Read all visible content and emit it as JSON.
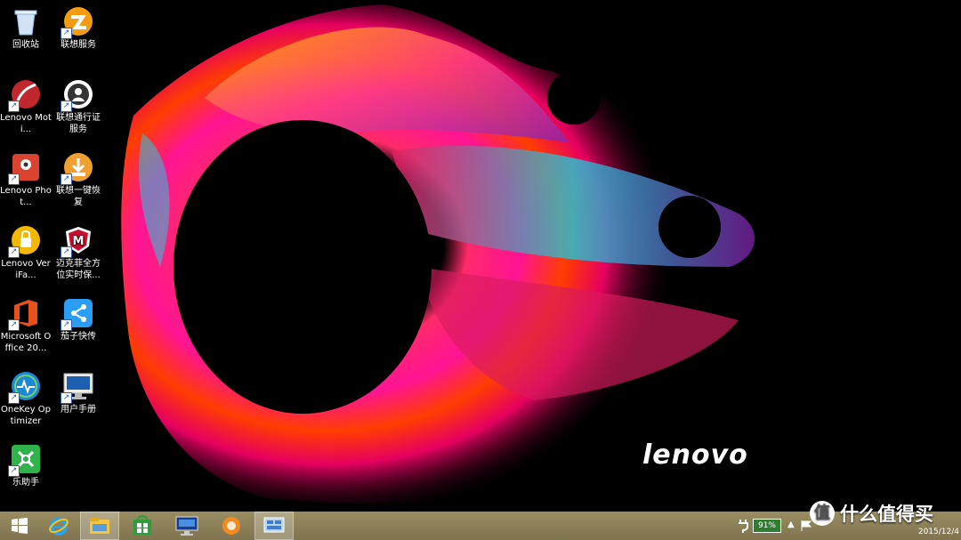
{
  "desktop_icons": [
    {
      "label": "回收站",
      "icon": "recycle-bin-icon"
    },
    {
      "label": "联想服务",
      "icon": "lenovo-service-icon"
    },
    {
      "label": "Lenovo Moti...",
      "icon": "lenovo-motion-icon"
    },
    {
      "label": "联想通行证服务",
      "icon": "lenovo-id-icon"
    },
    {
      "label": "Lenovo Phot...",
      "icon": "lenovo-photo-icon"
    },
    {
      "label": "联想一键恢复",
      "icon": "lenovo-onekey-recovery-icon"
    },
    {
      "label": "Lenovo VeriFa...",
      "icon": "lenovo-verifaces-icon"
    },
    {
      "label": "迈克菲全方位实时保...",
      "icon": "mcafee-icon"
    },
    {
      "label": "Microsoft Office 20...",
      "icon": "office-icon"
    },
    {
      "label": "茄子快传",
      "icon": "shareit-icon"
    },
    {
      "label": "OneKey Optimizer",
      "icon": "onekey-optimizer-icon"
    },
    {
      "label": "用户手册",
      "icon": "user-manual-icon"
    },
    {
      "label": "乐助手",
      "icon": "le-assistant-icon"
    }
  ],
  "wallpaper": {
    "brand": "lenovo"
  },
  "taskbar": {
    "buttons": [
      "start-icon",
      "internet-explorer-icon",
      "file-explorer-icon",
      "store-icon",
      "lenovo-monitor-icon",
      "browser-icon",
      "control-panel-icon"
    ],
    "battery": "91%",
    "clock_date": "2015/12/4"
  },
  "watermark": {
    "badge": "值",
    "text": "什么值得买"
  },
  "colors": {
    "taskbar": "#8f845b",
    "battery": "#2f7d2f"
  }
}
